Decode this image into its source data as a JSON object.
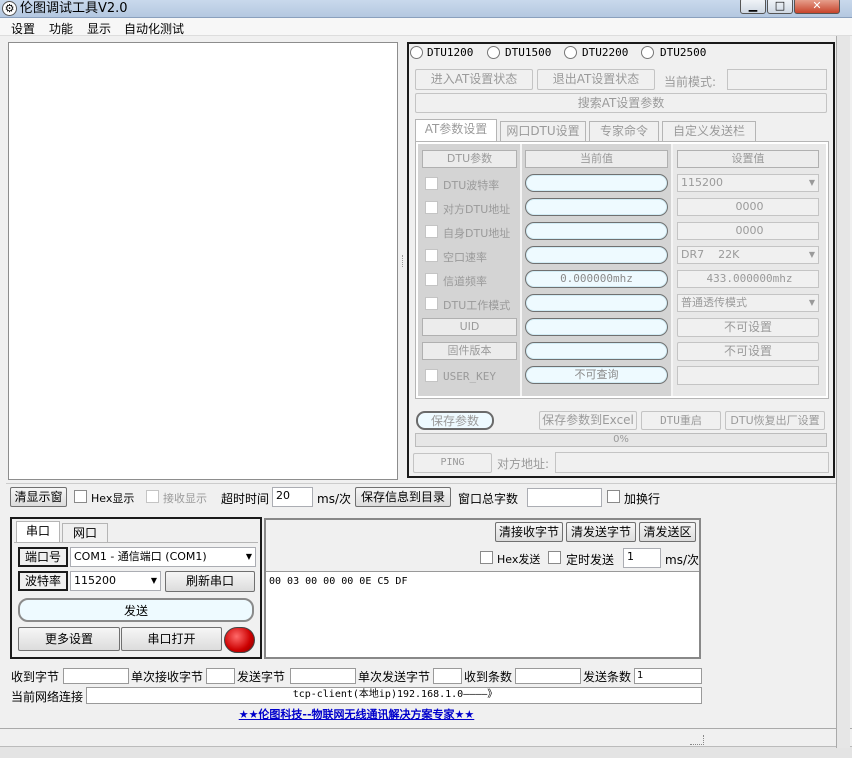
{
  "window": {
    "title": "伦图调试工具V2.0",
    "minimize": "▁",
    "maximize": "□",
    "close": "✕"
  },
  "menu": [
    "设置",
    "功能",
    "显示",
    "自动化测试"
  ],
  "dtu_models": [
    "DTU1200",
    "DTU1500",
    "DTU2200",
    "DTU2500"
  ],
  "at_controls": {
    "enter_at": "进入AT设置状态",
    "exit_at": "退出AT设置状态",
    "current_mode_label": "当前模式:",
    "current_mode_value": "",
    "search_params": "搜索AT设置参数"
  },
  "tabs": [
    "AT参数设置",
    "网口DTU设置",
    "专家命令",
    "自定义发送栏"
  ],
  "param_table": {
    "headers": [
      "DTU参数",
      "当前值",
      "设置值"
    ],
    "rows": [
      {
        "name": "DTU波特率",
        "checkbox": true,
        "current": "",
        "setting": "115200",
        "setting_type": "select"
      },
      {
        "name": "对方DTU地址",
        "checkbox": true,
        "current": "",
        "setting": "0000",
        "setting_type": "input"
      },
      {
        "name": "自身DTU地址",
        "checkbox": true,
        "current": "",
        "setting": "0000",
        "setting_type": "input"
      },
      {
        "name": "空口速率",
        "checkbox": true,
        "current": "",
        "setting": "DR7    22K",
        "setting_type": "select"
      },
      {
        "name": "信道频率",
        "checkbox": true,
        "current": "0.000000mhz",
        "setting": "433.000000mhz",
        "setting_type": "input"
      },
      {
        "name": "DTU工作模式",
        "checkbox": true,
        "current": "",
        "setting": "普通透传模式",
        "setting_type": "select"
      },
      {
        "name": "UID",
        "checkbox": false,
        "current": "",
        "setting": "不可设置",
        "setting_type": "button"
      },
      {
        "name": "固件版本",
        "checkbox": false,
        "current": "",
        "setting": "不可设置",
        "setting_type": "button"
      },
      {
        "name": "USER_KEY",
        "checkbox": true,
        "current": "不可查询",
        "setting": "",
        "setting_type": "input"
      }
    ]
  },
  "param_actions": {
    "save": "保存参数",
    "save_excel": "保存参数到Excel",
    "reboot": "DTU重启",
    "factory": "DTU恢复出厂设置",
    "progress_text": "0%",
    "progress": 0
  },
  "ping": {
    "button": "PING",
    "addr_label": "对方地址:",
    "addr_value": ""
  },
  "display_toolbar": {
    "clear": "清显示窗",
    "hex_display": "Hex显示",
    "recv_display": "接收显示",
    "timeout_label": "超时时间",
    "timeout_value": "20",
    "timeout_unit": "ms/次",
    "save_info": "保存信息到目录",
    "total_label": "窗口总字数",
    "total_value": "",
    "newline": "加换行"
  },
  "port_panel": {
    "tabs": [
      "串口",
      "网口"
    ],
    "port_label": "端口号",
    "port_value": "COM1 - 通信端口 (COM1)",
    "baud_label": "波特率",
    "baud_value": "115200",
    "refresh": "刷新串口",
    "send": "发送",
    "more": "更多设置",
    "open": "串口打开"
  },
  "send_panel": {
    "clear_recv": "清接收字节",
    "clear_send": "清发送字节",
    "clear_send_area": "清发送区",
    "hex_send": "Hex发送",
    "timed_send": "定时发送",
    "interval": "1",
    "interval_unit": "ms/次",
    "content": "00 03 00 00 00 0E C5 DF"
  },
  "stats": {
    "recv_bytes": "收到字节",
    "recv_bytes_val": "",
    "single_recv": "单次接收字节",
    "single_recv_val": "",
    "send_bytes": "发送字节",
    "send_bytes_val": "",
    "single_send": "单次发送字节",
    "single_send_val": "",
    "recv_count": "收到条数",
    "recv_count_val": "",
    "send_count": "发送条数",
    "send_count_val": "1"
  },
  "connection": {
    "label": "当前网络连接",
    "value": "tcp-client(本地ip)192.168.1.0————》"
  },
  "footer_link": "★★伦图科技--物联网无线通讯解决方案专家★★",
  "colors": {
    "link": "#0000cc",
    "status_led": "#cc0000"
  }
}
